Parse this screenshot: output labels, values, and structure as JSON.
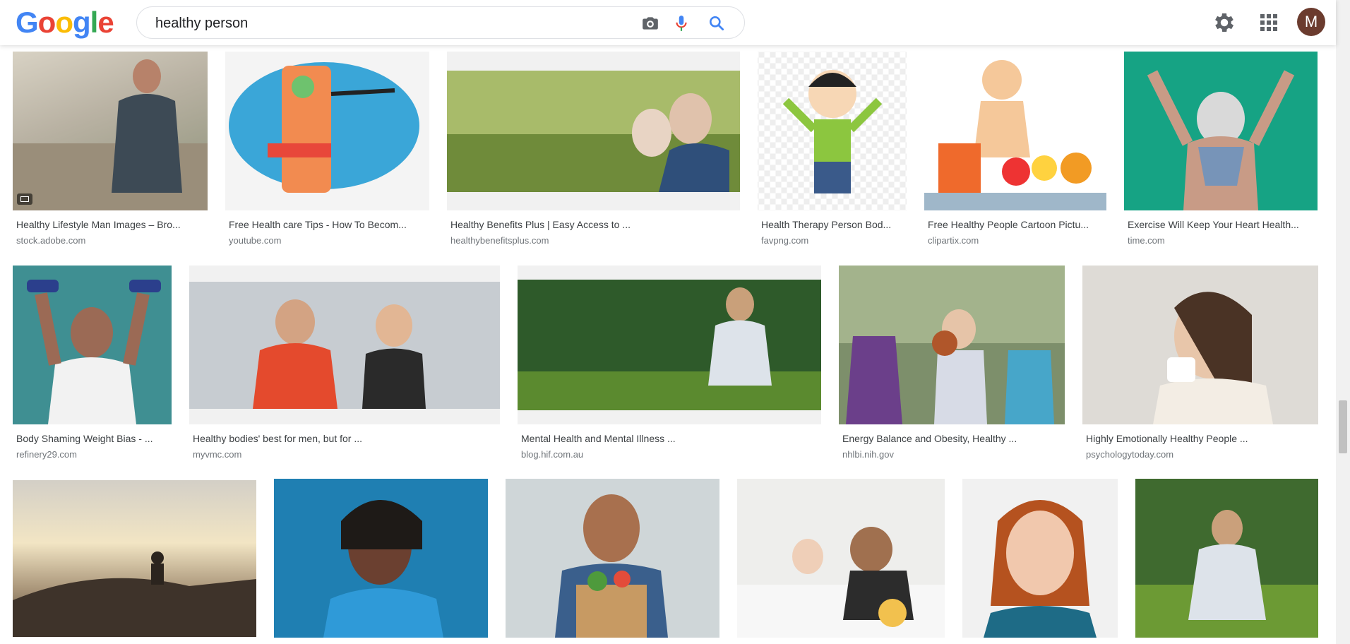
{
  "search": {
    "query": "healthy person",
    "logo": [
      "G",
      "o",
      "o",
      "g",
      "l",
      "e"
    ]
  },
  "header": {
    "avatar_letter": "M"
  },
  "results": [
    {
      "title": "Healthy Lifestyle Man Images – Bro...",
      "source": "stock.adobe.com"
    },
    {
      "title": "Free Health care Tips - How To Becom...",
      "source": "youtube.com"
    },
    {
      "title": "Healthy Benefits Plus | Easy Access to ...",
      "source": "healthybenefitsplus.com"
    },
    {
      "title": "Health Therapy Person Bod...",
      "source": "favpng.com"
    },
    {
      "title": "Free Healthy People Cartoon Pictu...",
      "source": "clipartix.com"
    },
    {
      "title": "Exercise Will Keep Your Heart Health...",
      "source": "time.com"
    },
    {
      "title": "Body Shaming Weight Bias - ...",
      "source": "refinery29.com"
    },
    {
      "title": "Healthy bodies' best for men, but for ...",
      "source": "myvmc.com"
    },
    {
      "title": "Mental Health and Mental Illness ...",
      "source": "blog.hif.com.au"
    },
    {
      "title": "Energy Balance and Obesity, Healthy ...",
      "source": "nhlbi.nih.gov"
    },
    {
      "title": "Highly Emotionally Healthy People ...",
      "source": "psychologytoday.com"
    }
  ],
  "colors": {
    "accent": "#4285f4",
    "mic_red": "#ea4335"
  }
}
